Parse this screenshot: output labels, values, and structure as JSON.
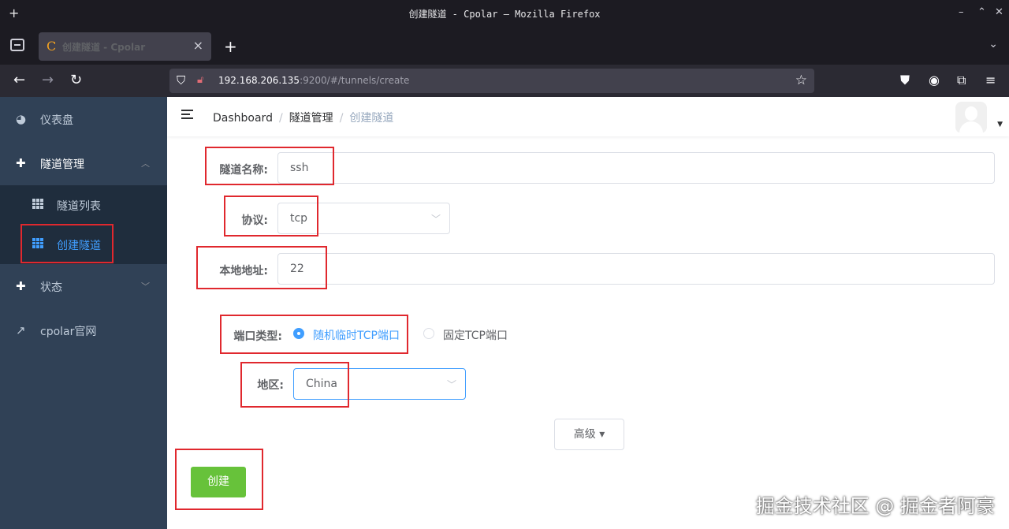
{
  "window": {
    "title": "创建隧道 - Cpolar — Mozilla Firefox"
  },
  "browser": {
    "tab_title": "创建隧道 - Cpolar",
    "favicon_letter": "C",
    "url_host": "192.168.206.135",
    "url_path": ":9200/#/tunnels/create"
  },
  "sidebar": {
    "items": [
      {
        "label": "仪表盘",
        "icon": "dashboard-icon"
      },
      {
        "label": "隧道管理",
        "icon": "tunnel-icon",
        "expanded": true
      },
      {
        "label": "状态",
        "icon": "status-icon"
      },
      {
        "label": "cpolar官网",
        "icon": "external-link-icon"
      }
    ],
    "subitems": [
      {
        "label": "隧道列表",
        "icon": "table-icon",
        "active": false
      },
      {
        "label": "创建隧道",
        "icon": "table-icon",
        "active": true
      }
    ]
  },
  "breadcrumb": {
    "items": [
      "Dashboard",
      "隧道管理",
      "创建隧道"
    ]
  },
  "form": {
    "name_label": "隧道名称:",
    "name_value": "ssh",
    "protocol_label": "协议:",
    "protocol_value": "tcp",
    "local_label": "本地地址:",
    "local_value": "22",
    "port_type_label": "端口类型:",
    "port_type_options": [
      "随机临时TCP端口",
      "固定TCP端口"
    ],
    "port_type_selected": "随机临时TCP端口",
    "region_label": "地区:",
    "region_value": "China",
    "advanced_label": "高级",
    "create_label": "创建"
  },
  "watermark": "掘金技术社区 @ 掘金者阿豪",
  "colors": {
    "sidebar_bg": "#304156",
    "submenu_bg": "#1f2d3d",
    "accent": "#409eff",
    "create_button": "#67c23a",
    "highlight_box": "#e0282e"
  }
}
